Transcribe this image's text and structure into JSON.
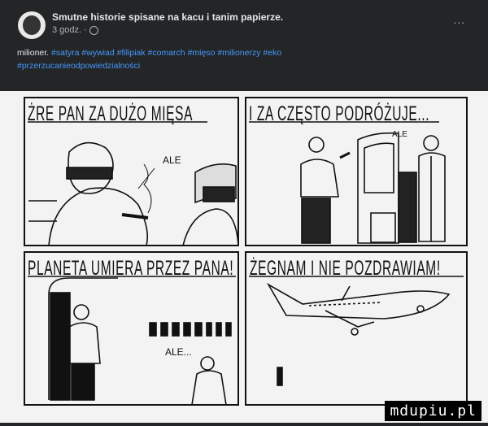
{
  "post": {
    "page_name": "Smutne historie spisane na kacu i tanim papierze.",
    "time": "3 godz.",
    "dot": "·",
    "more": "...",
    "caption_text": "milioner.",
    "hashtags": [
      "#satyra",
      "#wywiad",
      "#filipiak",
      "#comarch",
      "#mięso",
      "#milionerzy",
      "#eko",
      "#przerzucanieodpowiedzialności"
    ]
  },
  "comic": {
    "panel1_title": "ŻRE PAN ZA DUŻO MIĘSA",
    "panel1_ale": "ALE",
    "panel2_title": "I ZA CZĘSTO PODRÓŻUJE...",
    "panel2_ale": "ALE",
    "panel3_title": "PLANETA UMIERA PRZEZ PANA!",
    "panel3_ale": "ALE...",
    "panel4_title": "ŻEGNAM I NIE POZDRAWIAM!"
  },
  "watermark": "mdupiu.pl",
  "icons": {
    "avatar": "page-avatar",
    "globe": "globe-icon",
    "more": "more-options-icon"
  }
}
